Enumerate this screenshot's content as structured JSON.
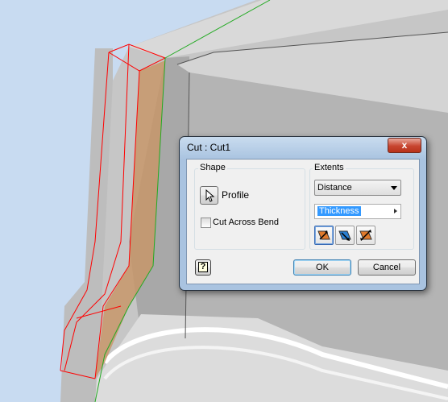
{
  "dialog": {
    "title": "Cut : Cut1",
    "close_glyph": "x",
    "shape": {
      "group_label": "Shape",
      "profile_label": "Profile",
      "cut_across_bend_label": "Cut Across Bend",
      "cut_across_bend_checked": false
    },
    "extents": {
      "group_label": "Extents",
      "type_selected": "Distance",
      "distance_value": "Thickness",
      "direction_buttons": [
        "direction-1-icon",
        "direction-2-icon",
        "symmetric-icon"
      ]
    },
    "ok_label": "OK",
    "cancel_label": "Cancel",
    "help_glyph": "?"
  },
  "colors": {
    "viewport_bg": "#c5d9f1",
    "part_face": "#bdbdbd",
    "edge_selected": "#ff0000",
    "edge_green": "#22aa22",
    "profile_fill": "#c7966a",
    "accent_selection": "#3399ff"
  }
}
